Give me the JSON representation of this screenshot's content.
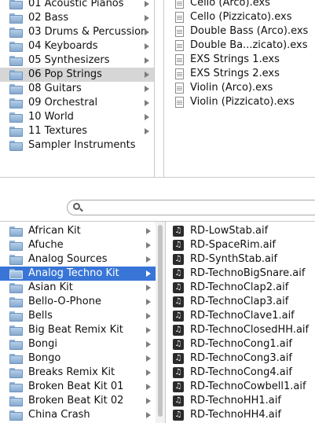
{
  "top_browser": {
    "folders": [
      {
        "label": "01 Acoustic Pianos"
      },
      {
        "label": "02 Bass"
      },
      {
        "label": "03 Drums & Percussion"
      },
      {
        "label": "04 Keyboards"
      },
      {
        "label": "05 Synthesizers"
      },
      {
        "label": "06 Pop Strings",
        "selected": true
      },
      {
        "label": "08 Guitars"
      },
      {
        "label": "09 Orchestral"
      },
      {
        "label": "10 World"
      },
      {
        "label": "11 Textures"
      },
      {
        "label": "Sampler Instruments",
        "no_arrow": true
      }
    ],
    "files": [
      {
        "label": "Cello (Arco).exs"
      },
      {
        "label": "Cello (Pizzicato).exs"
      },
      {
        "label": "Double Bass (Arco).exs"
      },
      {
        "label": "Double Ba...zicato).exs"
      },
      {
        "label": "EXS Strings 1.exs"
      },
      {
        "label": "EXS Strings 2.exs"
      },
      {
        "label": "Violin (Arco).exs"
      },
      {
        "label": "Violin (Pizzicato).exs"
      }
    ]
  },
  "search": {
    "placeholder": "",
    "value": ""
  },
  "bottom_browser": {
    "kits": [
      {
        "label": "African Kit"
      },
      {
        "label": "Afuche"
      },
      {
        "label": "Analog Sources"
      },
      {
        "label": "Analog Techno Kit",
        "selected": true
      },
      {
        "label": "Asian Kit"
      },
      {
        "label": "Bello-O-Phone"
      },
      {
        "label": "Bells"
      },
      {
        "label": "Big Beat Remix Kit"
      },
      {
        "label": "Bongi"
      },
      {
        "label": "Bongo"
      },
      {
        "label": "Breaks Remix Kit"
      },
      {
        "label": "Broken Beat Kit 01"
      },
      {
        "label": "Broken Beat Kit 02"
      },
      {
        "label": "China Crash"
      }
    ],
    "files": [
      {
        "label": "RD-LowStab.aif"
      },
      {
        "label": "RD-SpaceRim.aif"
      },
      {
        "label": "RD-SynthStab.aif"
      },
      {
        "label": "RD-TechnoBigSnare.aif"
      },
      {
        "label": "RD-TechnoClap2.aif"
      },
      {
        "label": "RD-TechnoClap3.aif"
      },
      {
        "label": "RD-TechnoClave1.aif"
      },
      {
        "label": "RD-TechnoClosedHH.aif"
      },
      {
        "label": "RD-TechnoCong1.aif"
      },
      {
        "label": "RD-TechnoCong3.aif"
      },
      {
        "label": "RD-TechnoCong4.aif"
      },
      {
        "label": "RD-TechnoCowbell1.aif"
      },
      {
        "label": "RD-TechnoHH1.aif"
      },
      {
        "label": "RD-TechnoHH4.aif"
      }
    ]
  },
  "icons": {
    "folder": "folder-icon",
    "exs_file": "exs-file-icon",
    "audio_file": "audio-file-icon",
    "disclosure": "chevron-right-icon",
    "search": "search-icon"
  },
  "colors": {
    "selection_gray": "#d6d6d6",
    "selection_blue": "#3875d7",
    "folder_blue": "#86a9cf"
  }
}
